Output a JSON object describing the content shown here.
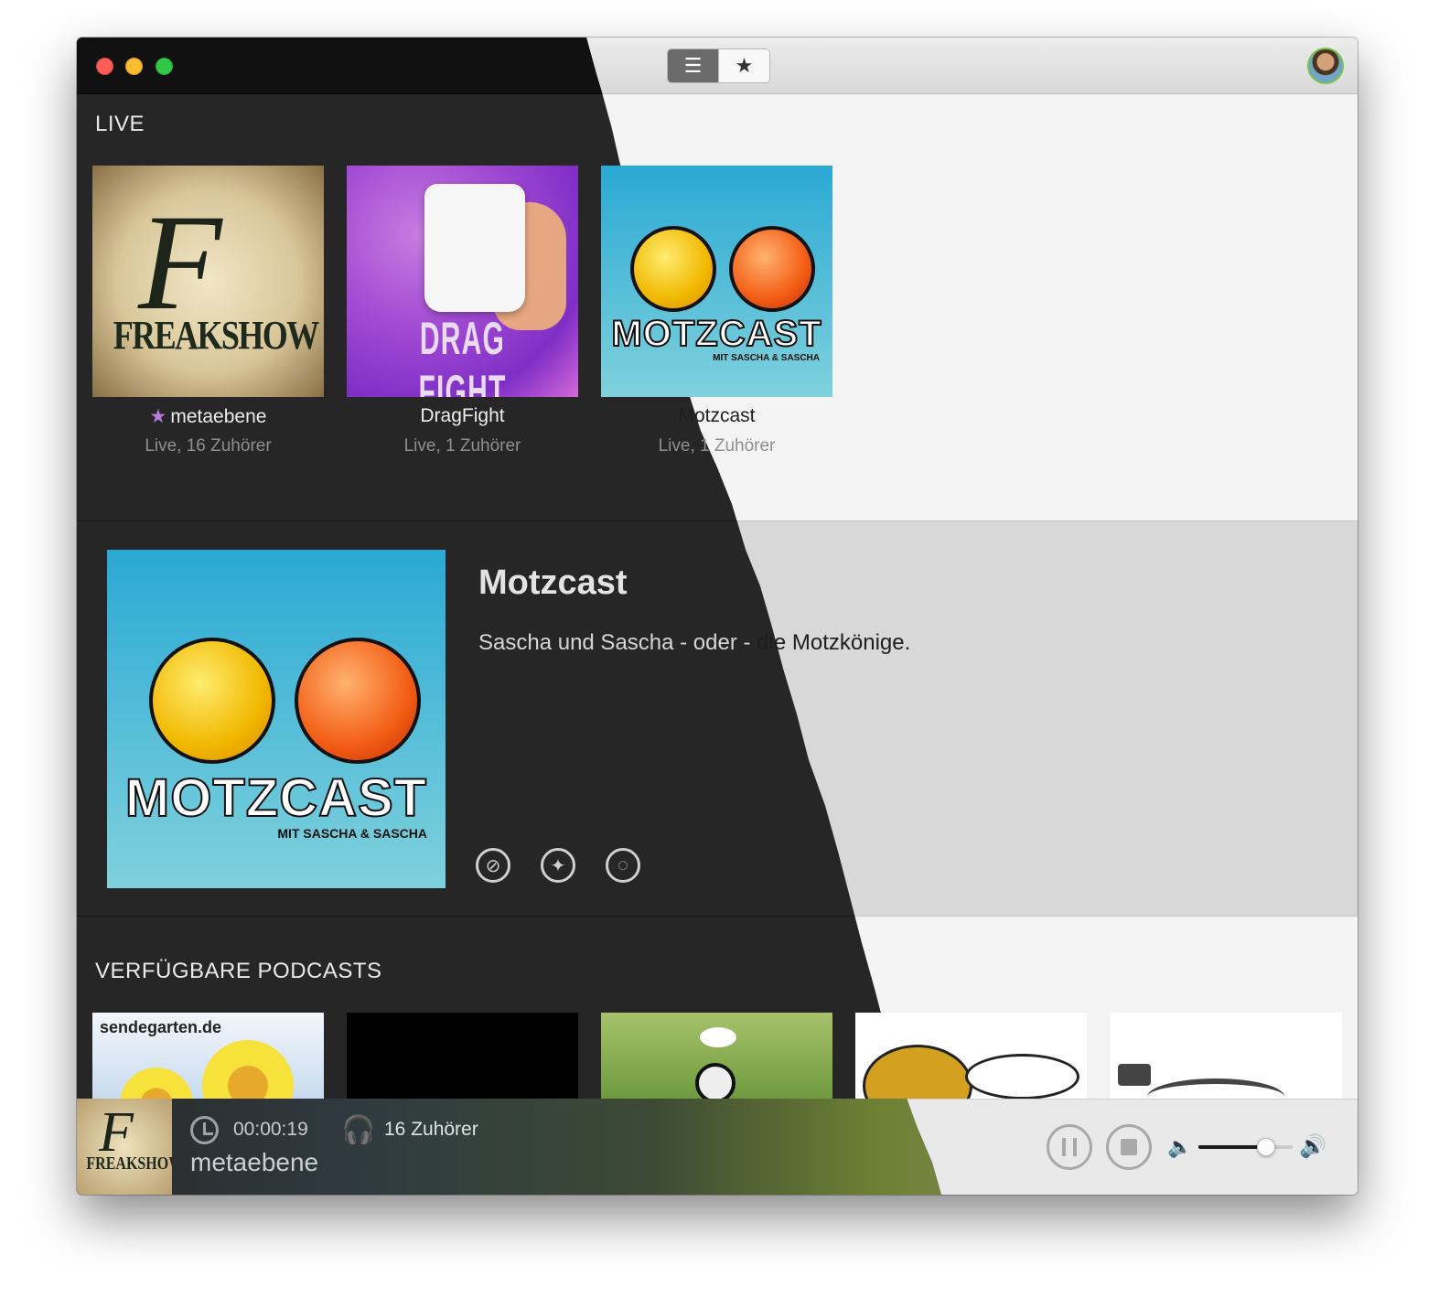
{
  "live": {
    "heading": "LIVE",
    "items": [
      {
        "name": "metaebene",
        "status": "Live, 16 Zuhörer",
        "favorite": true,
        "art_text": "FREAKSHOW",
        "art_letter": "F"
      },
      {
        "name": "DragFight",
        "status": "Live, 1 Zuhörer",
        "favorite": false,
        "art_text": "DRAG FIGHT"
      },
      {
        "name": "Motzcast",
        "status": "Live, 1 Zuhörer",
        "favorite": false,
        "art_text": "MOTZCAST",
        "art_sub": "MIT SASCHA & SASCHA"
      }
    ]
  },
  "detail": {
    "title": "Motzcast",
    "description_dark": "Sascha und Sascha - oder - ",
    "description_light": "die Motzkönige.",
    "art_text": "MOTZCAST",
    "art_sub": "MIT SASCHA & SASCHA",
    "actions": [
      "safari-icon",
      "twitter-icon",
      "chat-icon"
    ]
  },
  "available": {
    "heading": "VERFÜGBARE PODCASTS",
    "first_label": "sendegarten.de"
  },
  "player": {
    "elapsed": "00:00:19",
    "listeners": "16 Zuhörer",
    "title": "metaebene",
    "art_letter": "F",
    "art_text": "FREAKSHOW",
    "volume": 0.72
  },
  "toolbar": {
    "list_glyph": "☰",
    "star_glyph": "★"
  },
  "colors": {
    "dark_bg": "#262626",
    "light_bg": "#f4f4f4",
    "favorite_star": "#b67ae0"
  }
}
